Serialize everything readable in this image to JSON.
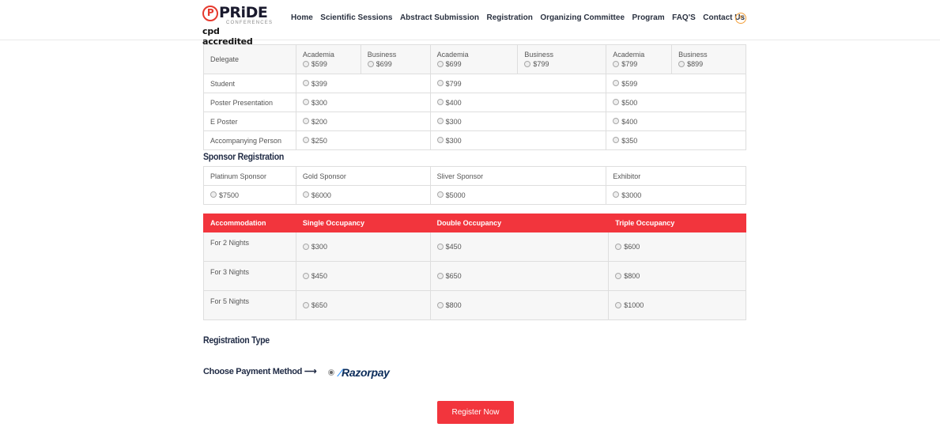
{
  "header": {
    "logo_pride": "PRiDE",
    "logo_conference": "CONFERENCES",
    "logo_cpd": "cpd accredited",
    "nav": [
      "Home",
      "Scientific Sessions",
      "Abstract Submission",
      "Registration",
      "Organizing Committee",
      "Program",
      "FAQ'S",
      "Contact Us"
    ],
    "more_icon": "plus-circle-icon"
  },
  "fees": {
    "delegate": {
      "label": "Delegate",
      "options": [
        {
          "type": "Academia",
          "price": "$599"
        },
        {
          "type": "Business",
          "price": "$699"
        },
        {
          "type": "Academia",
          "price": "$699"
        },
        {
          "type": "Business",
          "price": "$799"
        },
        {
          "type": "Academia",
          "price": "$799"
        },
        {
          "type": "Business",
          "price": "$899"
        }
      ]
    },
    "rows": [
      {
        "label": "Student",
        "prices": [
          "$399",
          "$799",
          "$599"
        ]
      },
      {
        "label": "Poster Presentation",
        "prices": [
          "$300",
          "$400",
          "$500"
        ]
      },
      {
        "label": "E Poster",
        "prices": [
          "$200",
          "$300",
          "$400"
        ]
      },
      {
        "label": "Accompanying Person",
        "prices": [
          "$250",
          "$300",
          "$350"
        ]
      }
    ]
  },
  "sponsor": {
    "title": "Sponsor Registration",
    "headers": [
      "Platinum Sponsor",
      "Gold Sponsor",
      "Sliver Sponsor",
      "Exhibitor"
    ],
    "prices": [
      "$7500",
      "$6000",
      "$5000",
      "$3000"
    ]
  },
  "accommodation": {
    "headers": [
      "Accommodation",
      "Single Occupancy",
      "Double Occupancy",
      "Triple Occupancy"
    ],
    "rows": [
      {
        "label": "For 2 Nights",
        "prices": [
          "$300",
          "$450",
          "$600"
        ]
      },
      {
        "label": "For 3 Nights",
        "prices": [
          "$450",
          "$650",
          "$800"
        ]
      },
      {
        "label": "For 5 Nights",
        "prices": [
          "$650",
          "$800",
          "$1000"
        ]
      }
    ]
  },
  "registration_type": {
    "title": "Registration Type"
  },
  "payment": {
    "label": "Choose Payment Method",
    "arrow": "⟶",
    "provider": "Razorpay"
  },
  "submit": {
    "label": "Register Now"
  },
  "colors": {
    "accent": "#f2353d",
    "heading": "#1f2a44"
  }
}
